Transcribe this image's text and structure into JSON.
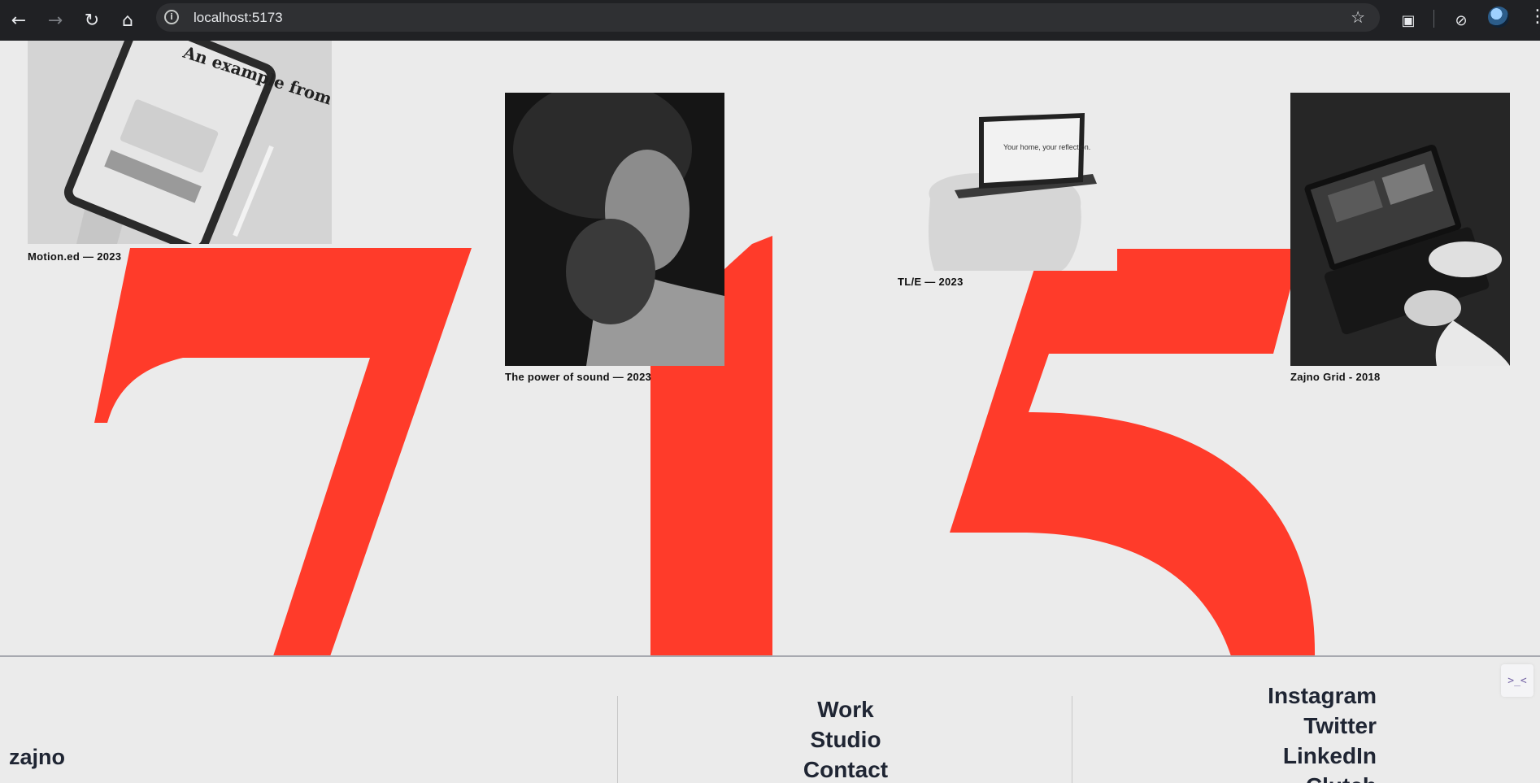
{
  "browser": {
    "url": "localhost:5173",
    "icons": [
      "back-icon",
      "forward-icon",
      "reload-icon",
      "home-icon",
      "info-icon",
      "star-icon",
      "extensions-icon",
      "performance-icon",
      "profile-avatar",
      "more-icon"
    ]
  },
  "hero": {
    "digits": "715",
    "accent_color": "#ff3b2a",
    "projects": [
      {
        "title": "Motion.ed — 2023",
        "image_text": "An example from classic animation"
      },
      {
        "title": "The power of sound — 2023"
      },
      {
        "title": "TL/E — 2023",
        "image_text": "Your home, your reflection."
      },
      {
        "title": "Zajno Grid - 2018"
      }
    ]
  },
  "footer": {
    "brand": "zajno",
    "menu": [
      "Work",
      "Studio",
      "Contact"
    ],
    "social": [
      "Instagram",
      "Twitter",
      "LinkedIn",
      "Clutch"
    ],
    "widget_icon": ">_<"
  }
}
